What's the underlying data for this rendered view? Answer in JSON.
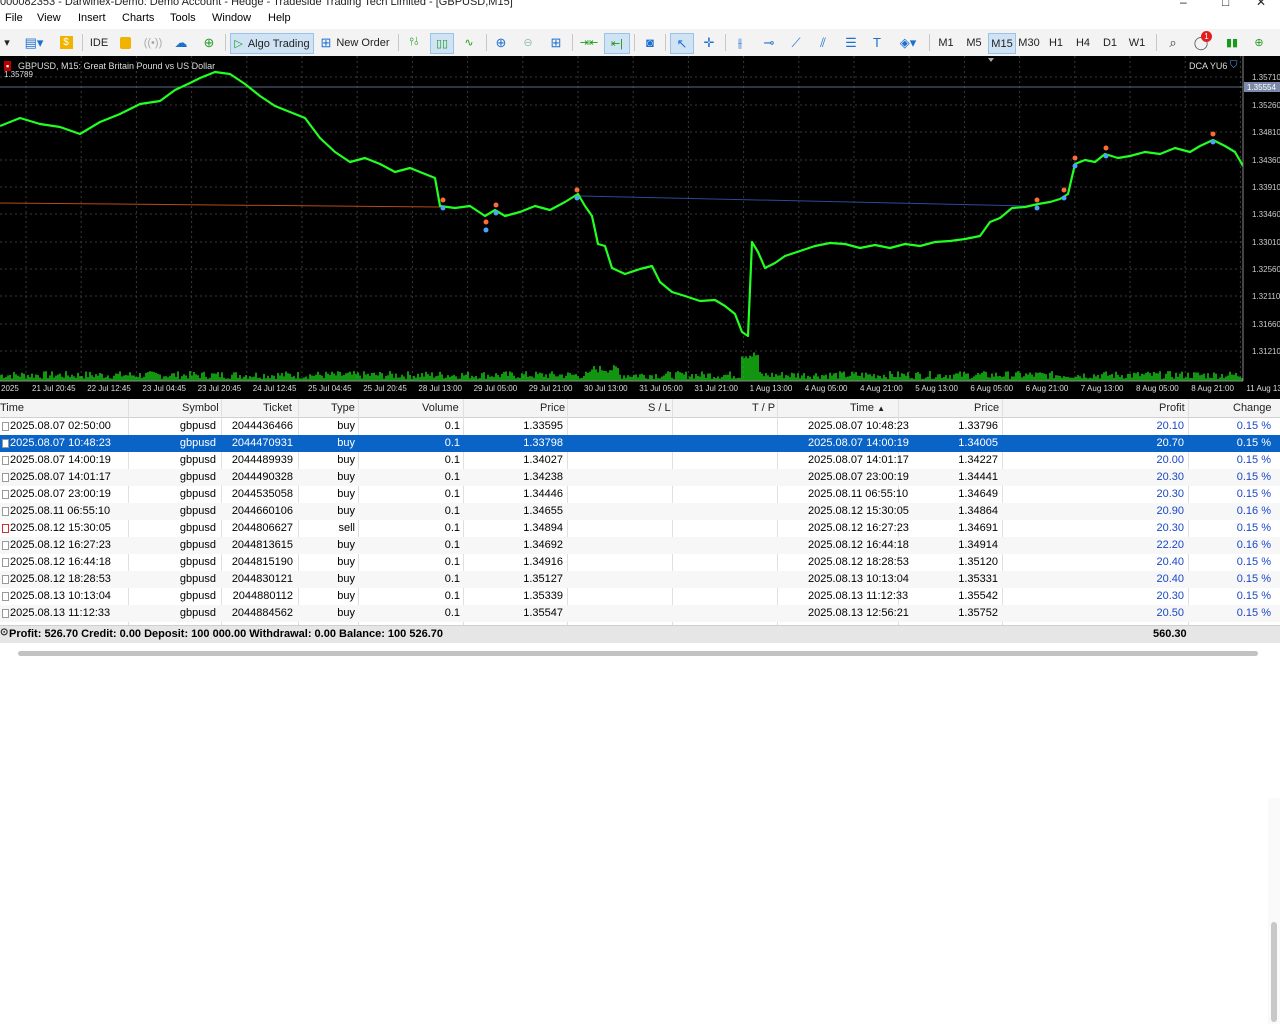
{
  "window": {
    "title": "000082353 - Darwinex-Demo: Demo Account - Hedge - Tradeside Trading Tech Limited - [GBPUSD,M15]"
  },
  "menu": [
    "File",
    "View",
    "Insert",
    "Charts",
    "Tools",
    "Window",
    "Help"
  ],
  "toolbar": {
    "ide": "IDE",
    "algo": "Algo Trading",
    "new_order": "New Order",
    "timeframes": [
      "M1",
      "M5",
      "M15",
      "M30",
      "H1",
      "H4",
      "D1",
      "W1"
    ],
    "active_tf": "M15",
    "notifications": "1"
  },
  "chart": {
    "symbol_info": "GBPUSD, M15:  Great Britain Pound vs US Dollar",
    "ea_label": "DCA YU6",
    "current_price": "1.35554",
    "corner_text": "1.35789",
    "price_levels": [
      "1.35710",
      "1.35260",
      "1.34810",
      "1.34360",
      "1.33910",
      "1.33460",
      "1.33010",
      "1.32560",
      "1.32110",
      "1.31660",
      "1.31210"
    ],
    "time_labels": [
      "2025",
      "21 Jul 20:45",
      "22 Jul 12:45",
      "23 Jul 04:45",
      "23 Jul 20:45",
      "24 Jul 12:45",
      "25 Jul 04:45",
      "25 Jul 20:45",
      "28 Jul 13:00",
      "29 Jul 05:00",
      "29 Jul 21:00",
      "30 Jul 13:00",
      "31 Jul 05:00",
      "31 Jul 21:00",
      "1 Aug 13:00",
      "4 Aug 05:00",
      "4 Aug 21:00",
      "5 Aug 13:00",
      "6 Aug 05:00",
      "6 Aug 21:00",
      "7 Aug 13:00",
      "8 Aug 05:00",
      "8 Aug 21:00",
      "11 Aug 13:00"
    ],
    "colors": {
      "line": "#22ff22",
      "volume": "#19c819",
      "background": "#000000"
    },
    "price_path": [
      [
        0,
        70
      ],
      [
        20,
        62
      ],
      [
        40,
        68
      ],
      [
        60,
        71
      ],
      [
        80,
        78
      ],
      [
        100,
        66
      ],
      [
        120,
        58
      ],
      [
        140,
        48
      ],
      [
        160,
        45
      ],
      [
        175,
        34
      ],
      [
        190,
        27
      ],
      [
        200,
        22
      ],
      [
        215,
        16
      ],
      [
        230,
        18
      ],
      [
        245,
        28
      ],
      [
        260,
        40
      ],
      [
        275,
        50
      ],
      [
        290,
        56
      ],
      [
        305,
        62
      ],
      [
        320,
        82
      ],
      [
        335,
        96
      ],
      [
        350,
        106
      ],
      [
        365,
        102
      ],
      [
        380,
        108
      ],
      [
        395,
        116
      ],
      [
        410,
        112
      ],
      [
        425,
        118
      ],
      [
        435,
        122
      ],
      [
        440,
        150
      ],
      [
        455,
        152
      ],
      [
        470,
        150
      ],
      [
        485,
        160
      ],
      [
        495,
        154
      ],
      [
        505,
        160
      ],
      [
        520,
        156
      ],
      [
        535,
        150
      ],
      [
        550,
        154
      ],
      [
        565,
        146
      ],
      [
        578,
        138
      ],
      [
        585,
        150
      ],
      [
        592,
        160
      ],
      [
        598,
        188
      ],
      [
        605,
        190
      ],
      [
        612,
        212
      ],
      [
        625,
        218
      ],
      [
        640,
        213
      ],
      [
        652,
        210
      ],
      [
        660,
        226
      ],
      [
        672,
        236
      ],
      [
        685,
        240
      ],
      [
        700,
        245
      ],
      [
        715,
        244
      ],
      [
        725,
        250
      ],
      [
        735,
        258
      ],
      [
        742,
        276
      ],
      [
        748,
        280
      ],
      [
        752,
        186
      ],
      [
        758,
        196
      ],
      [
        765,
        212
      ],
      [
        775,
        207
      ],
      [
        785,
        200
      ],
      [
        800,
        195
      ],
      [
        815,
        190
      ],
      [
        830,
        187
      ],
      [
        845,
        188
      ],
      [
        860,
        192
      ],
      [
        875,
        189
      ],
      [
        890,
        192
      ],
      [
        905,
        188
      ],
      [
        920,
        190
      ],
      [
        935,
        186
      ],
      [
        950,
        185
      ],
      [
        965,
        183
      ],
      [
        980,
        180
      ],
      [
        990,
        166
      ],
      [
        1000,
        162
      ],
      [
        1012,
        152
      ],
      [
        1025,
        151
      ],
      [
        1038,
        148
      ],
      [
        1050,
        146
      ],
      [
        1060,
        143
      ],
      [
        1068,
        138
      ],
      [
        1075,
        108
      ],
      [
        1085,
        104
      ],
      [
        1095,
        106
      ],
      [
        1105,
        98
      ],
      [
        1118,
        102
      ],
      [
        1130,
        100
      ],
      [
        1145,
        96
      ],
      [
        1160,
        98
      ],
      [
        1175,
        92
      ],
      [
        1190,
        96
      ],
      [
        1200,
        90
      ],
      [
        1213,
        84
      ],
      [
        1225,
        90
      ],
      [
        1235,
        96
      ],
      [
        1243,
        110
      ]
    ],
    "trade_markers": [
      [
        443,
        148
      ],
      [
        486,
        170
      ],
      [
        496,
        153
      ],
      [
        577,
        138
      ],
      [
        1037,
        148
      ],
      [
        1064,
        138
      ],
      [
        1075,
        106
      ],
      [
        1106,
        96
      ],
      [
        1213,
        82
      ]
    ]
  },
  "grid": {
    "columns": [
      "Time",
      "Symbol",
      "Ticket",
      "Type",
      "Volume",
      "Price",
      "S / L",
      "T / P",
      "Time",
      "Price",
      "Profit",
      "Change"
    ],
    "rows": [
      {
        "time": "2025.08.07 02:50:00",
        "symbol": "gbpusd",
        "ticket": "2044436466",
        "type": "buy",
        "volume": "0.1",
        "price": "1.33595",
        "sl": "",
        "tp": "",
        "close_time": "2025.08.07 10:48:23",
        "close_price": "1.33796",
        "profit": "20.10",
        "change": "0.15 %",
        "selected": false
      },
      {
        "time": "2025.08.07 10:48:23",
        "symbol": "gbpusd",
        "ticket": "2044470931",
        "type": "buy",
        "volume": "0.1",
        "price": "1.33798",
        "sl": "",
        "tp": "",
        "close_time": "2025.08.07 14:00:19",
        "close_price": "1.34005",
        "profit": "20.70",
        "change": "0.15 %",
        "selected": true
      },
      {
        "time": "2025.08.07 14:00:19",
        "symbol": "gbpusd",
        "ticket": "2044489939",
        "type": "buy",
        "volume": "0.1",
        "price": "1.34027",
        "sl": "",
        "tp": "",
        "close_time": "2025.08.07 14:01:17",
        "close_price": "1.34227",
        "profit": "20.00",
        "change": "0.15 %",
        "selected": false
      },
      {
        "time": "2025.08.07 14:01:17",
        "symbol": "gbpusd",
        "ticket": "2044490328",
        "type": "buy",
        "volume": "0.1",
        "price": "1.34238",
        "sl": "",
        "tp": "",
        "close_time": "2025.08.07 23:00:19",
        "close_price": "1.34441",
        "profit": "20.30",
        "change": "0.15 %",
        "selected": false
      },
      {
        "time": "2025.08.07 23:00:19",
        "symbol": "gbpusd",
        "ticket": "2044535058",
        "type": "buy",
        "volume": "0.1",
        "price": "1.34446",
        "sl": "",
        "tp": "",
        "close_time": "2025.08.11 06:55:10",
        "close_price": "1.34649",
        "profit": "20.30",
        "change": "0.15 %",
        "selected": false
      },
      {
        "time": "2025.08.11 06:55:10",
        "symbol": "gbpusd",
        "ticket": "2044660106",
        "type": "buy",
        "volume": "0.1",
        "price": "1.34655",
        "sl": "",
        "tp": "",
        "close_time": "2025.08.12 15:30:05",
        "close_price": "1.34864",
        "profit": "20.90",
        "change": "0.16 %",
        "selected": false
      },
      {
        "time": "2025.08.12 15:30:05",
        "symbol": "gbpusd",
        "ticket": "2044806627",
        "type": "sell",
        "volume": "0.1",
        "price": "1.34894",
        "sl": "",
        "tp": "",
        "close_time": "2025.08.12 16:27:23",
        "close_price": "1.34691",
        "profit": "20.30",
        "change": "0.15 %",
        "selected": false
      },
      {
        "time": "2025.08.12 16:27:23",
        "symbol": "gbpusd",
        "ticket": "2044813615",
        "type": "buy",
        "volume": "0.1",
        "price": "1.34692",
        "sl": "",
        "tp": "",
        "close_time": "2025.08.12 16:44:18",
        "close_price": "1.34914",
        "profit": "22.20",
        "change": "0.16 %",
        "selected": false
      },
      {
        "time": "2025.08.12 16:44:18",
        "symbol": "gbpusd",
        "ticket": "2044815190",
        "type": "buy",
        "volume": "0.1",
        "price": "1.34916",
        "sl": "",
        "tp": "",
        "close_time": "2025.08.12 18:28:53",
        "close_price": "1.35120",
        "profit": "20.40",
        "change": "0.15 %",
        "selected": false
      },
      {
        "time": "2025.08.12 18:28:53",
        "symbol": "gbpusd",
        "ticket": "2044830121",
        "type": "buy",
        "volume": "0.1",
        "price": "1.35127",
        "sl": "",
        "tp": "",
        "close_time": "2025.08.13 10:13:04",
        "close_price": "1.35331",
        "profit": "20.40",
        "change": "0.15 %",
        "selected": false
      },
      {
        "time": "2025.08.13 10:13:04",
        "symbol": "gbpusd",
        "ticket": "2044880112",
        "type": "buy",
        "volume": "0.1",
        "price": "1.35339",
        "sl": "",
        "tp": "",
        "close_time": "2025.08.13 11:12:33",
        "close_price": "1.35542",
        "profit": "20.30",
        "change": "0.15 %",
        "selected": false
      },
      {
        "time": "2025.08.13 11:12:33",
        "symbol": "gbpusd",
        "ticket": "2044884562",
        "type": "buy",
        "volume": "0.1",
        "price": "1.35547",
        "sl": "",
        "tp": "",
        "close_time": "2025.08.13 12:56:21",
        "close_price": "1.35752",
        "profit": "20.50",
        "change": "0.15 %",
        "selected": false
      }
    ]
  },
  "summary": {
    "text": "Profit: 526.70  Credit: 0.00  Deposit: 100 000.00  Withdrawal: 0.00  Balance: 100 526.70",
    "total": "560.30"
  }
}
